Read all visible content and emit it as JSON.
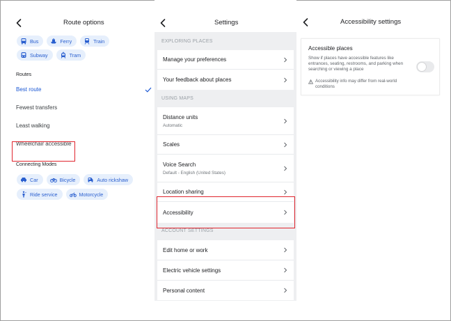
{
  "route_options": {
    "title": "Route options",
    "transit_modes": [
      {
        "label": "Bus",
        "icon": "bus-icon"
      },
      {
        "label": "Ferry",
        "icon": "ferry-icon"
      },
      {
        "label": "Train",
        "icon": "train-icon"
      },
      {
        "label": "Subway",
        "icon": "subway-icon"
      },
      {
        "label": "Tram",
        "icon": "tram-icon"
      }
    ],
    "routes_header": "Routes",
    "routes": [
      {
        "label": "Best route",
        "selected": true
      },
      {
        "label": "Fewest transfers",
        "selected": false
      },
      {
        "label": "Least walking",
        "selected": false
      },
      {
        "label": "Wheelchair accessible",
        "selected": false
      }
    ],
    "connecting_header": "Connecting Modes",
    "connecting_modes": [
      {
        "label": "Car",
        "icon": "car-icon"
      },
      {
        "label": "Bicycle",
        "icon": "bicycle-icon"
      },
      {
        "label": "Auto rickshaw",
        "icon": "auto-rickshaw-icon"
      },
      {
        "label": "Ride service",
        "icon": "ride-service-icon"
      },
      {
        "label": "Motorcycle",
        "icon": "motorcycle-icon"
      }
    ]
  },
  "settings": {
    "title": "Settings",
    "sections": [
      {
        "header": "EXPLORING PLACES",
        "items": [
          {
            "label": "Manage your preferences",
            "sub": ""
          },
          {
            "label": "Your feedback about places",
            "sub": ""
          }
        ]
      },
      {
        "header": "USING MAPS",
        "items": [
          {
            "label": "Distance units",
            "sub": "Automatic"
          },
          {
            "label": "Scales",
            "sub": ""
          },
          {
            "label": "Voice Search",
            "sub": "Default - English (United States)"
          },
          {
            "label": "Location sharing",
            "sub": ""
          },
          {
            "label": "Accessibility",
            "sub": ""
          }
        ]
      },
      {
        "header": "ACCOUNT SETTINGS",
        "items": [
          {
            "label": "Edit home or work",
            "sub": ""
          },
          {
            "label": "Electric vehicle settings",
            "sub": ""
          },
          {
            "label": "Personal content",
            "sub": ""
          }
        ]
      }
    ]
  },
  "accessibility": {
    "title": "Accessibility settings",
    "option_title": "Accessible places",
    "option_desc": "Show if places have accessible features like entrances, seating, restrooms, and parking when searching or viewing a place",
    "toggle_on": false,
    "note": "Accessibility info may differ from real-world conditions"
  },
  "colors": {
    "accent": "#1a57d4",
    "chip_bg": "#e6effc",
    "highlight": "#e0242d",
    "settings_bg": "#eeeff1"
  }
}
